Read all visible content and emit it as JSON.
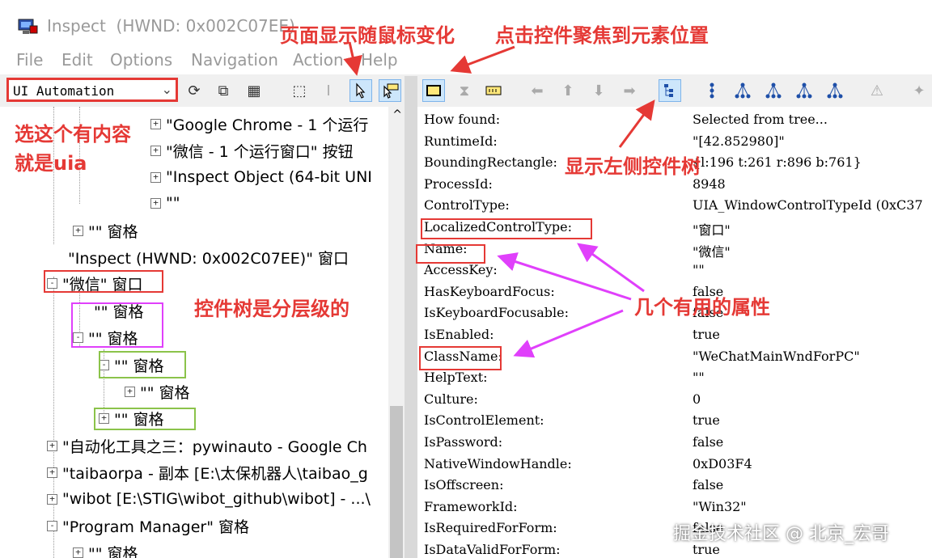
{
  "window": {
    "title": "Inspect  (HWND: 0x002C07EE)"
  },
  "menu": [
    "File",
    "Edit",
    "Options",
    "Navigation",
    "Action",
    "Help"
  ],
  "toolbar": {
    "mode": "UI Automation"
  },
  "tree": {
    "items": [
      {
        "label": "\"Google Chrome - 1 个运行",
        "exp": "+"
      },
      {
        "label": "\"微信 - 1 个运行窗口\" 按钮",
        "exp": "+"
      },
      {
        "label": "\"Inspect Object (64-bit UNI",
        "exp": "+"
      },
      {
        "label": "\"\"",
        "exp": "+"
      },
      {
        "label": "\"\" 窗格",
        "exp": "+"
      },
      {
        "label": "\"Inspect  (HWND: 0x002C07EE)\" 窗口",
        "exp": ""
      },
      {
        "label": "\"微信\" 窗口",
        "exp": "-"
      },
      {
        "label": "\"\" 窗格",
        "exp": ""
      },
      {
        "label": "\"\" 窗格",
        "exp": "-"
      },
      {
        "label": "\"\" 窗格",
        "exp": "-"
      },
      {
        "label": "\"\" 窗格",
        "exp": "+"
      },
      {
        "label": "\"\" 窗格",
        "exp": "+"
      },
      {
        "label": "\"自动化工具之三：pywinauto - Google Ch",
        "exp": "+"
      },
      {
        "label": "\"taibaorpa - 副本 [E:\\太保机器人\\taibao_g",
        "exp": "+"
      },
      {
        "label": "\"wibot [E:\\STIG\\wibot_github\\wibot] - ...\\",
        "exp": "+"
      },
      {
        "label": "\"Program Manager\" 窗格",
        "exp": "-"
      },
      {
        "label": "\"\" 窗格",
        "exp": "+"
      }
    ]
  },
  "properties": [
    {
      "key": "How found:",
      "value": "Selected from tree..."
    },
    {
      "key": "RuntimeId:",
      "value": "\"[42.852980]\""
    },
    {
      "key": "BoundingRectangle:",
      "value": "{l:196 t:261 r:896 b:761}"
    },
    {
      "key": "ProcessId:",
      "value": "8948"
    },
    {
      "key": "ControlType:",
      "value": "UIA_WindowControlTypeId (0xC37"
    },
    {
      "key": "LocalizedControlType:",
      "value": "\"窗口\""
    },
    {
      "key": "Name:",
      "value": "\"微信\""
    },
    {
      "key": "AccessKey:",
      "value": "\"\""
    },
    {
      "key": "HasKeyboardFocus:",
      "value": "false"
    },
    {
      "key": "IsKeyboardFocusable:",
      "value": "false"
    },
    {
      "key": "IsEnabled:",
      "value": "true"
    },
    {
      "key": "ClassName:",
      "value": "\"WeChatMainWndForPC\""
    },
    {
      "key": "HelpText:",
      "value": "\"\""
    },
    {
      "key": "Culture:",
      "value": "0"
    },
    {
      "key": "IsControlElement:",
      "value": "true"
    },
    {
      "key": "IsPassword:",
      "value": "false"
    },
    {
      "key": "NativeWindowHandle:",
      "value": "0xD03F4"
    },
    {
      "key": "IsOffscreen:",
      "value": "false"
    },
    {
      "key": "FrameworkId:",
      "value": "\"Win32\""
    },
    {
      "key": "IsRequiredForForm:",
      "value": "false"
    },
    {
      "key": "IsDataValidForForm:",
      "value": "true"
    }
  ],
  "annotations": {
    "page_changes": "页面显示随鼠标变化",
    "click_focus": "点击控件聚焦到元素位置",
    "select_uia_1": "选这个有内容",
    "select_uia_2": "就是uia",
    "show_tree": "显示左侧控件树",
    "tree_levels": "控件树是分层级的",
    "useful_props": "几个有用的属性"
  },
  "watermark": "掘金技术社区 @ 北京_宏哥",
  "colors": {
    "annotation": "#e53935",
    "magenta": "#e040fb",
    "green": "#8bc34a"
  }
}
